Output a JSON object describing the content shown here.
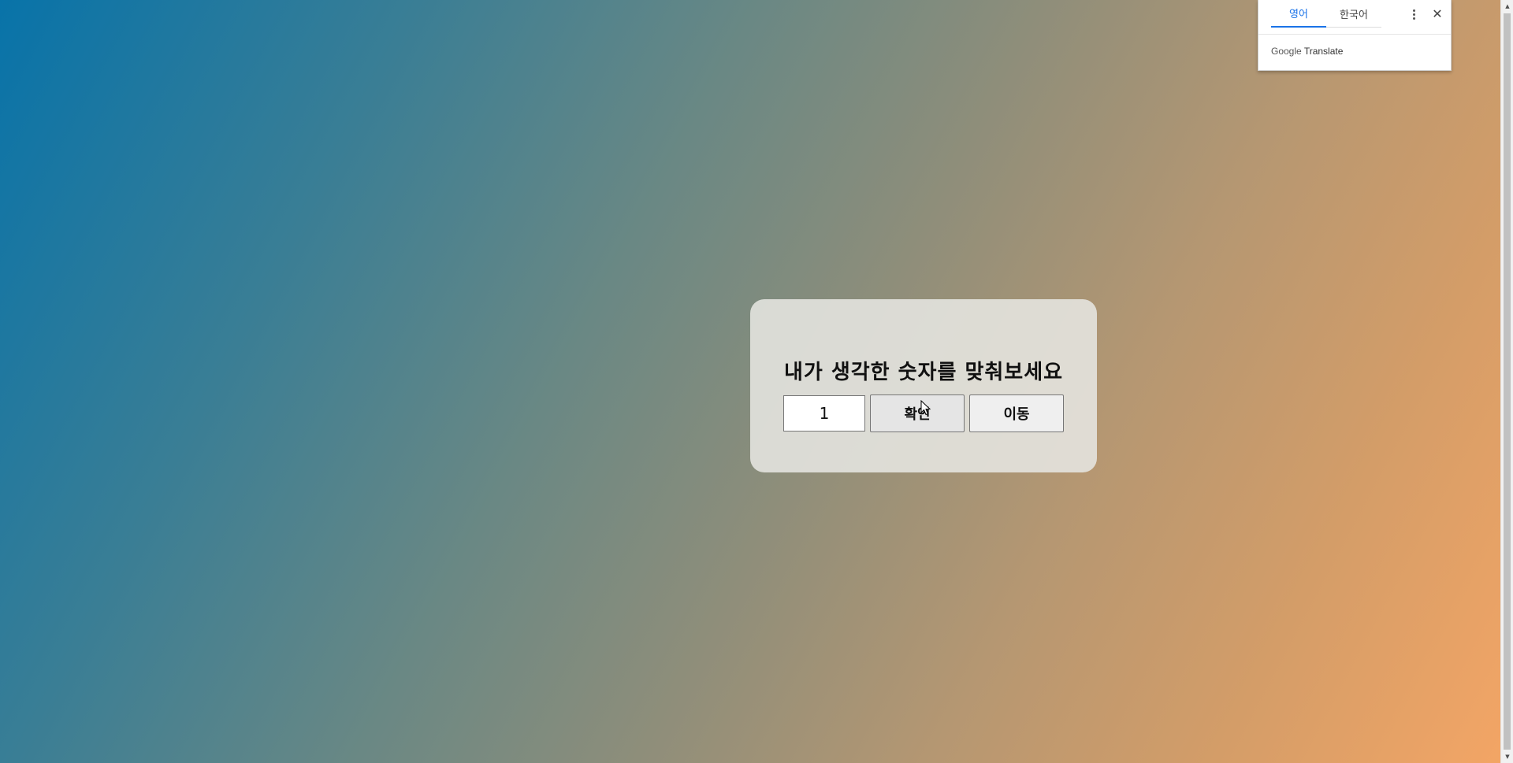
{
  "game": {
    "title": "내가 생각한 숫자를 맞춰보세요",
    "input_value": "1",
    "confirm_label": "확인",
    "move_label": "이동"
  },
  "translate_popup": {
    "tabs": [
      {
        "label": "영어",
        "active": true
      },
      {
        "label": "한국어",
        "active": false
      }
    ],
    "menu_icon": "more-vert-icon",
    "close_icon": "close-icon",
    "brand_google": "Google",
    "brand_translate": "Translate"
  },
  "colors": {
    "gradient_start": "#0873a9",
    "gradient_end": "#f3a565",
    "tab_active": "#1a73e8"
  }
}
